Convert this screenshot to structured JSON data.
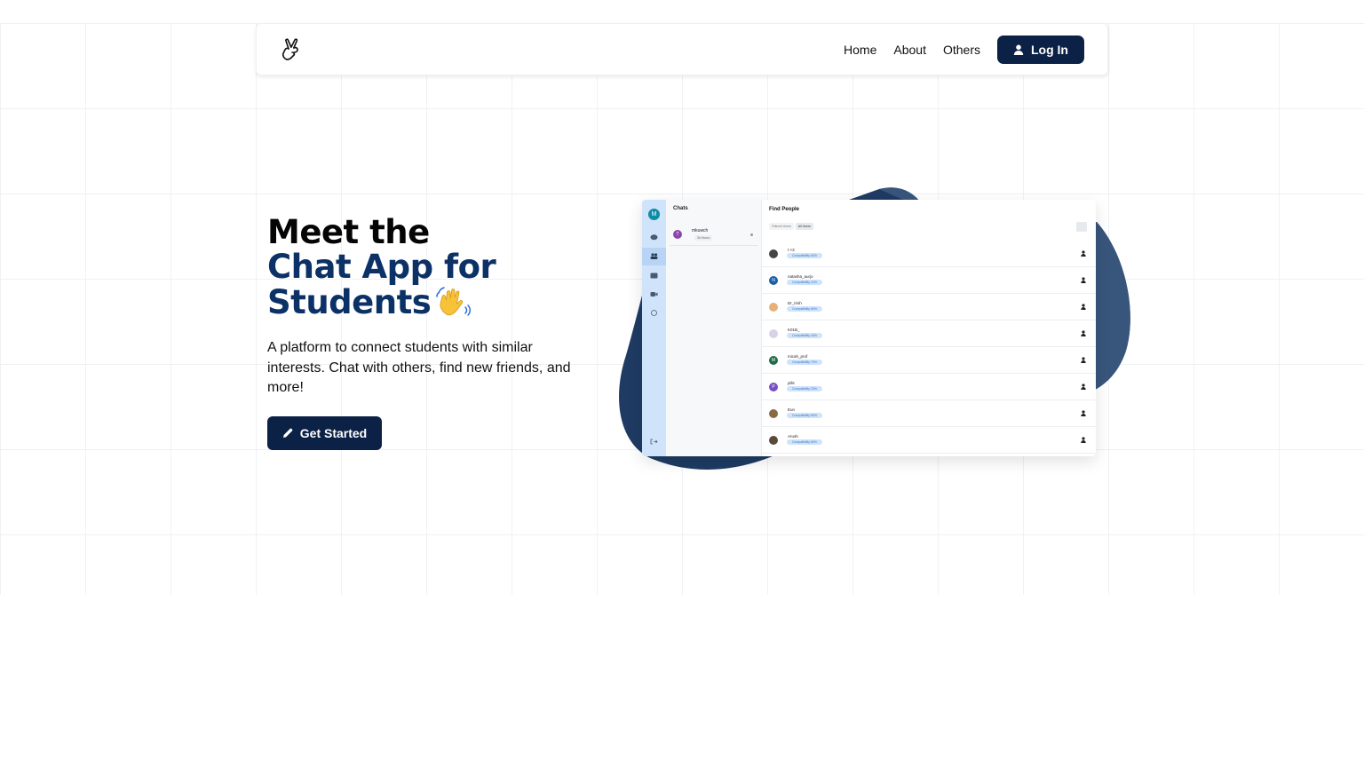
{
  "nav": {
    "links": [
      "Home",
      "About",
      "Others"
    ],
    "login_label": "Log In"
  },
  "hero": {
    "line1": "Meet the",
    "line2": "Chat App for",
    "line3": "Students",
    "subtitle": "A platform to connect students with similar interests. Chat with others, find new friends, and more!",
    "cta_label": "Get Started"
  },
  "mockup": {
    "rail_avatar": "M",
    "chats_title": "Chats",
    "chat": {
      "initial": "T",
      "name": "mkuwch",
      "time": "3h Hours"
    },
    "find_title": "Find People",
    "filters": [
      "Filtered Users",
      "All Users"
    ],
    "people": [
      {
        "name": "t <3",
        "badge": "Compatibility 60%",
        "initial": "",
        "color": "#444444"
      },
      {
        "name": "natasha_aurjo",
        "badge": "Compatibility 41%",
        "initial": "N",
        "color": "#1b5fa8"
      },
      {
        "name": "Dr_Irish",
        "badge": "Compatibility 60%",
        "initial": "",
        "color": "#e8b07a"
      },
      {
        "name": "K01B_",
        "badge": "Compatibility 44%",
        "initial": "",
        "color": "#d9d1e8"
      },
      {
        "name": "micah_prof",
        "badge": "Compatibility 70%",
        "initial": "M",
        "color": "#1e6b47"
      },
      {
        "name": "pills",
        "badge": "Compatibility 29%",
        "initial": "P",
        "color": "#7a4fc4"
      },
      {
        "name": "Eun",
        "badge": "Compatibility 60%",
        "initial": "",
        "color": "#8a6a45"
      },
      {
        "name": "Arush",
        "badge": "Compatibility 60%",
        "initial": "",
        "color": "#5a4a3a"
      }
    ]
  },
  "colors": {
    "brand": "#0b2145",
    "accent": "#0b3166",
    "blob": "#1f3b63"
  }
}
